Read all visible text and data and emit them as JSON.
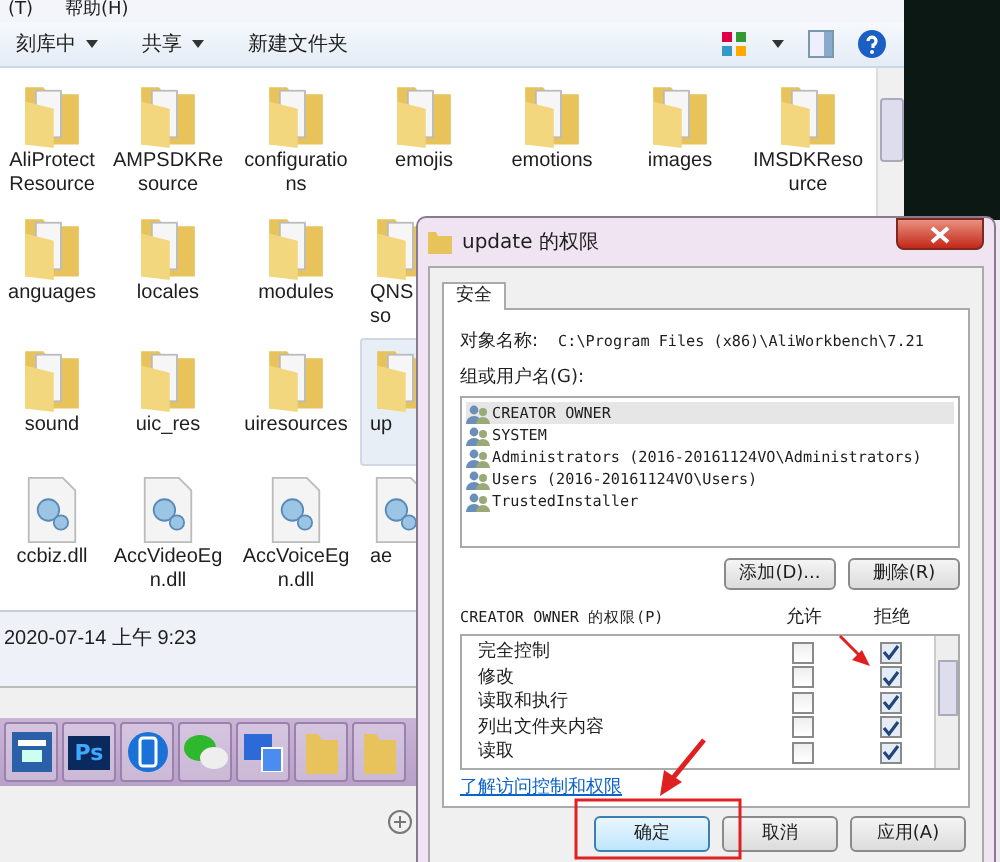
{
  "menu_bar": [
    "(T)",
    "帮助(H)"
  ],
  "toolbar": [
    {
      "label": "刻库中",
      "dropdown": true
    },
    {
      "label": "共享",
      "dropdown": true
    },
    {
      "label": "新建文件夹",
      "dropdown": false
    }
  ],
  "file_rows": [
    [
      {
        "label": "AliProtect Resource",
        "kind": "folder",
        "selected": false
      },
      {
        "label": "AMPSDKResource",
        "kind": "folder",
        "selected": false
      },
      {
        "label": "configurations",
        "kind": "folder",
        "selected": false
      },
      {
        "label": "emojis",
        "kind": "folder",
        "selected": false
      },
      {
        "label": "emotions",
        "kind": "folder",
        "selected": false
      },
      {
        "label": "images",
        "kind": "folder",
        "selected": false
      },
      {
        "label": "IMSDKResource",
        "kind": "folder",
        "selected": false
      }
    ],
    [
      {
        "label": "anguages",
        "kind": "folder",
        "selected": false
      },
      {
        "label": "locales",
        "kind": "folder",
        "selected": false
      },
      {
        "label": "modules",
        "kind": "folder",
        "selected": false
      },
      {
        "label": "QNS so",
        "kind": "folder",
        "selected": false
      }
    ],
    [
      {
        "label": "sound",
        "kind": "folder",
        "selected": false
      },
      {
        "label": "uic_res",
        "kind": "folder",
        "selected": false
      },
      {
        "label": "uiresources",
        "kind": "folder",
        "selected": false
      },
      {
        "label": "up",
        "kind": "folder",
        "selected": true
      }
    ],
    [
      {
        "label": "ccbiz.dll",
        "kind": "dll",
        "selected": false
      },
      {
        "label": "AccVideoEgn.dll",
        "kind": "dll",
        "selected": false
      },
      {
        "label": "AccVoiceEgn.dll",
        "kind": "dll",
        "selected": false
      },
      {
        "label": "ae",
        "kind": "dll",
        "selected": false
      }
    ]
  ],
  "details": {
    "date": "2020-07-14 上午 9:23"
  },
  "taskbar": [
    {
      "kind": "app"
    },
    {
      "kind": "ps",
      "label": "Ps"
    },
    {
      "kind": "phone"
    },
    {
      "kind": "chat"
    },
    {
      "kind": "doc"
    },
    {
      "kind": "folder"
    },
    {
      "kind": "folder"
    }
  ],
  "dialog": {
    "title": "update 的权限",
    "tabs": [
      {
        "label": "安全",
        "selected": true
      }
    ],
    "object_label": "对象名称:",
    "object_path": "C:\\Program Files (x86)\\AliWorkbench\\7.21",
    "users_label": "组或用户名(G):",
    "users": [
      {
        "name": "CREATOR OWNER",
        "selected": true
      },
      {
        "name": "SYSTEM",
        "selected": false
      },
      {
        "name": "Administrators (2016-20161124VO\\Administrators)",
        "selected": false
      },
      {
        "name": "Users (2016-20161124VO\\Users)",
        "selected": false
      },
      {
        "name": "TrustedInstaller",
        "selected": false
      }
    ],
    "user_buttons": [
      "添加(D)...",
      "删除(R)"
    ],
    "permissions_label": "CREATOR OWNER 的权限(P)",
    "allow_label": "允许",
    "deny_label": "拒绝",
    "permissions": [
      {
        "name": "完全控制",
        "allow": false,
        "deny": true
      },
      {
        "name": "修改",
        "allow": false,
        "deny": true
      },
      {
        "name": "读取和执行",
        "allow": false,
        "deny": true
      },
      {
        "name": "列出文件夹内容",
        "allow": false,
        "deny": true
      },
      {
        "name": "读取",
        "allow": false,
        "deny": true
      }
    ],
    "link": "了解访问控制和权限",
    "buttons": [
      {
        "label": "确定",
        "focused": true
      },
      {
        "label": "取消",
        "focused": false
      },
      {
        "label": "应用(A)",
        "focused": false
      }
    ]
  }
}
